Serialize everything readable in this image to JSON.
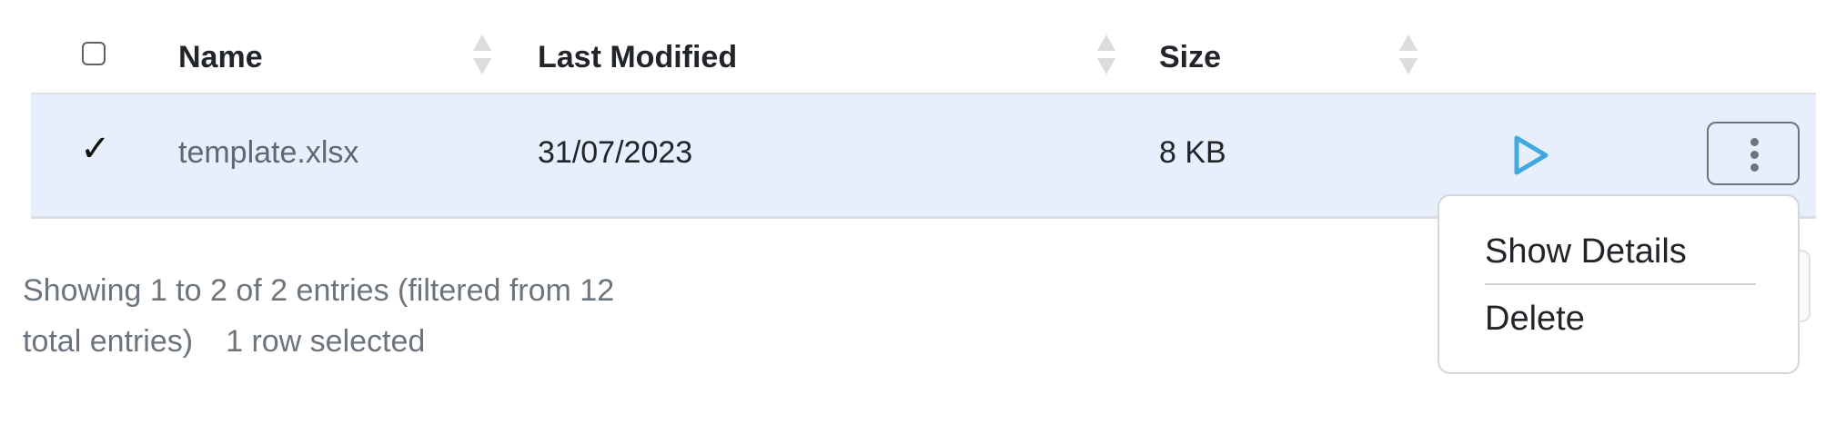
{
  "table": {
    "columns": [
      {
        "label": "Name"
      },
      {
        "label": "Last Modified"
      },
      {
        "label": "Size"
      }
    ],
    "rows": [
      {
        "selected": true,
        "name": "template.xlsx",
        "last_modified": "31/07/2023",
        "size": "8 KB"
      }
    ]
  },
  "footer": {
    "info_line1": "Showing 1 to 2 of 2 entries (filtered from 12",
    "info_line2": "total entries)",
    "selected_text": "1 row selected"
  },
  "context_menu": {
    "items": [
      {
        "label": "Show Details"
      },
      {
        "label": "Delete"
      }
    ]
  },
  "colors": {
    "selected_row_bg": "#e8effc",
    "play_icon": "#3fa9e0"
  },
  "icons": {
    "row_action": "play-icon",
    "more_actions": "vertical-ellipsis-icon"
  }
}
